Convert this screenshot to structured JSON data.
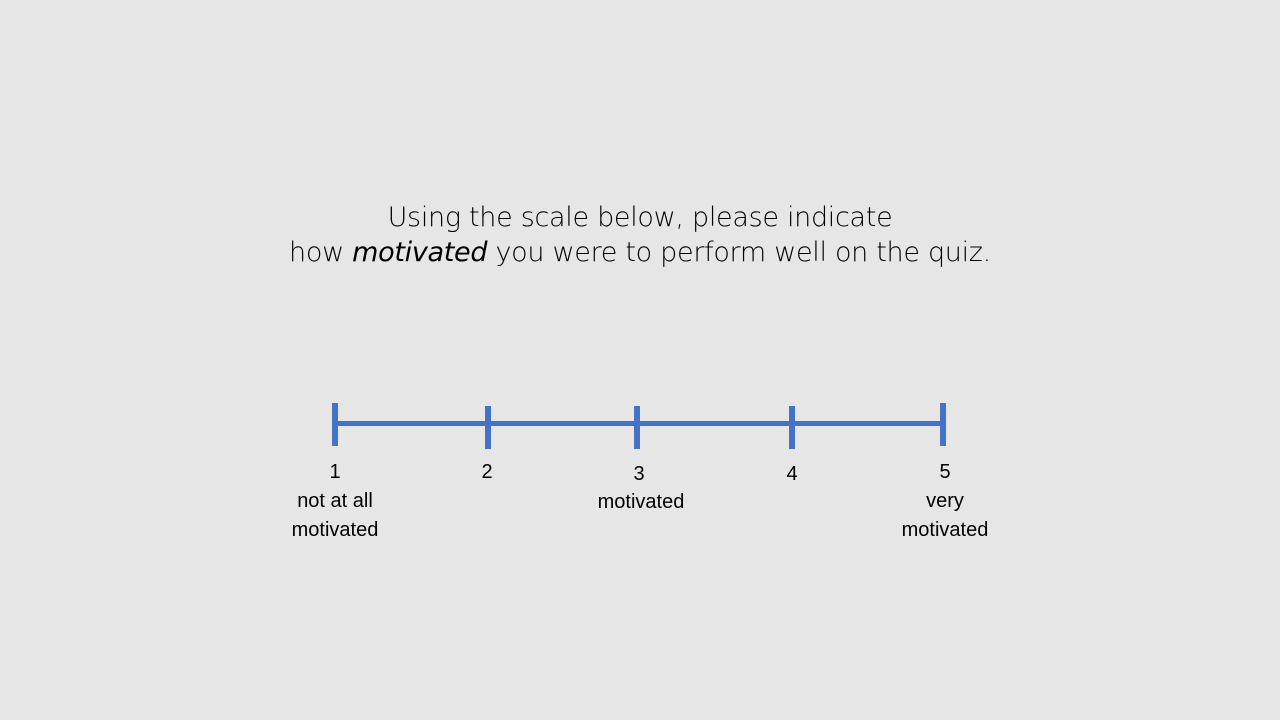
{
  "question": {
    "line1": "Using the scale below, please indicate",
    "line2_prefix": "how ",
    "line2_emphasis": "motivated",
    "line2_suffix": " you were to perform well on the quiz."
  },
  "scale": {
    "color": "#4472c4",
    "points": [
      {
        "number": "1",
        "label": "not at all motivated"
      },
      {
        "number": "2",
        "label": ""
      },
      {
        "number": "3",
        "label": "motivated"
      },
      {
        "number": "4",
        "label": ""
      },
      {
        "number": "5",
        "label": "very motivated"
      }
    ]
  }
}
